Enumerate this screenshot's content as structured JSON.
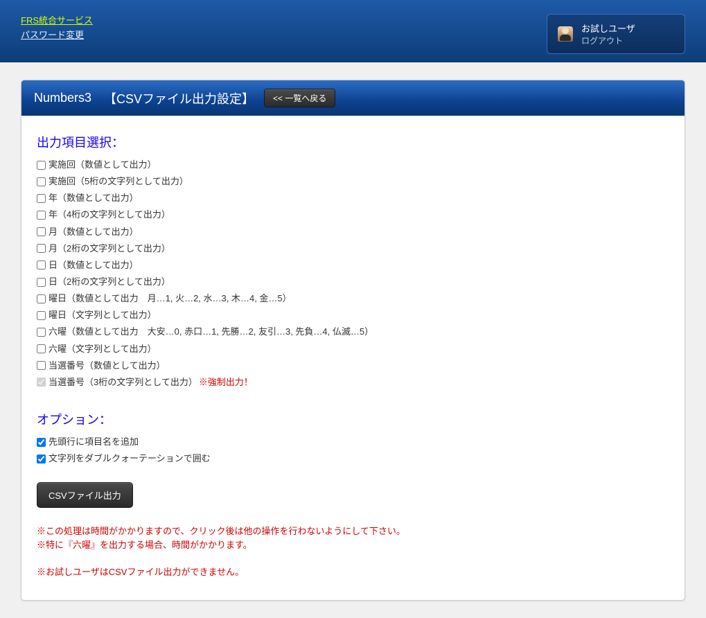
{
  "header": {
    "service_link": "FRS統合サービス",
    "password_change_link": "パスワード変更",
    "user": {
      "name": "お試しユーザ",
      "logout": "ログアウト"
    }
  },
  "panel": {
    "title_name": "Numbers3",
    "title_section": "【CSVファイル出力設定】",
    "back_button": "<< 一覧へ戻る"
  },
  "output_items": {
    "heading": "出力項目選択：",
    "items": [
      {
        "label": "実施回（数値として出力）",
        "checked": false,
        "disabled": false
      },
      {
        "label": "実施回（5桁の文字列として出力）",
        "checked": false,
        "disabled": false
      },
      {
        "label": "年（数値として出力）",
        "checked": false,
        "disabled": false
      },
      {
        "label": "年（4桁の文字列として出力）",
        "checked": false,
        "disabled": false
      },
      {
        "label": "月（数値として出力）",
        "checked": false,
        "disabled": false
      },
      {
        "label": "月（2桁の文字列として出力）",
        "checked": false,
        "disabled": false
      },
      {
        "label": "日（数値として出力）",
        "checked": false,
        "disabled": false
      },
      {
        "label": "日（2桁の文字列として出力）",
        "checked": false,
        "disabled": false
      },
      {
        "label": "曜日（数値として出力　月…1, 火…2, 水…3, 木…4, 金…5）",
        "checked": false,
        "disabled": false
      },
      {
        "label": "曜日（文字列として出力）",
        "checked": false,
        "disabled": false
      },
      {
        "label": "六曜（数値として出力　大安…0, 赤口…1, 先勝…2, 友引…3, 先負…4, 仏滅…5）",
        "checked": false,
        "disabled": false
      },
      {
        "label": "六曜（文字列として出力）",
        "checked": false,
        "disabled": false
      },
      {
        "label": "当選番号（数値として出力）",
        "checked": false,
        "disabled": false
      },
      {
        "label": "当選番号（3桁の文字列として出力）",
        "checked": true,
        "disabled": true,
        "forced_note": "※強制出力！"
      }
    ]
  },
  "options": {
    "heading": "オプション：",
    "items": [
      {
        "label": "先頭行に項目名を追加",
        "checked": true
      },
      {
        "label": "文字列をダブルクォーテーションで囲む",
        "checked": true
      }
    ]
  },
  "csv_button": "CSVファイル出力",
  "warnings": {
    "line1": "※この処理は時間がかかりますので、クリック後は他の操作を行わないようにして下さい。",
    "line2": "※特に『六曜』を出力する場合、時間がかかります。",
    "line3": "※お試しユーザはCSVファイル出力ができません。"
  }
}
